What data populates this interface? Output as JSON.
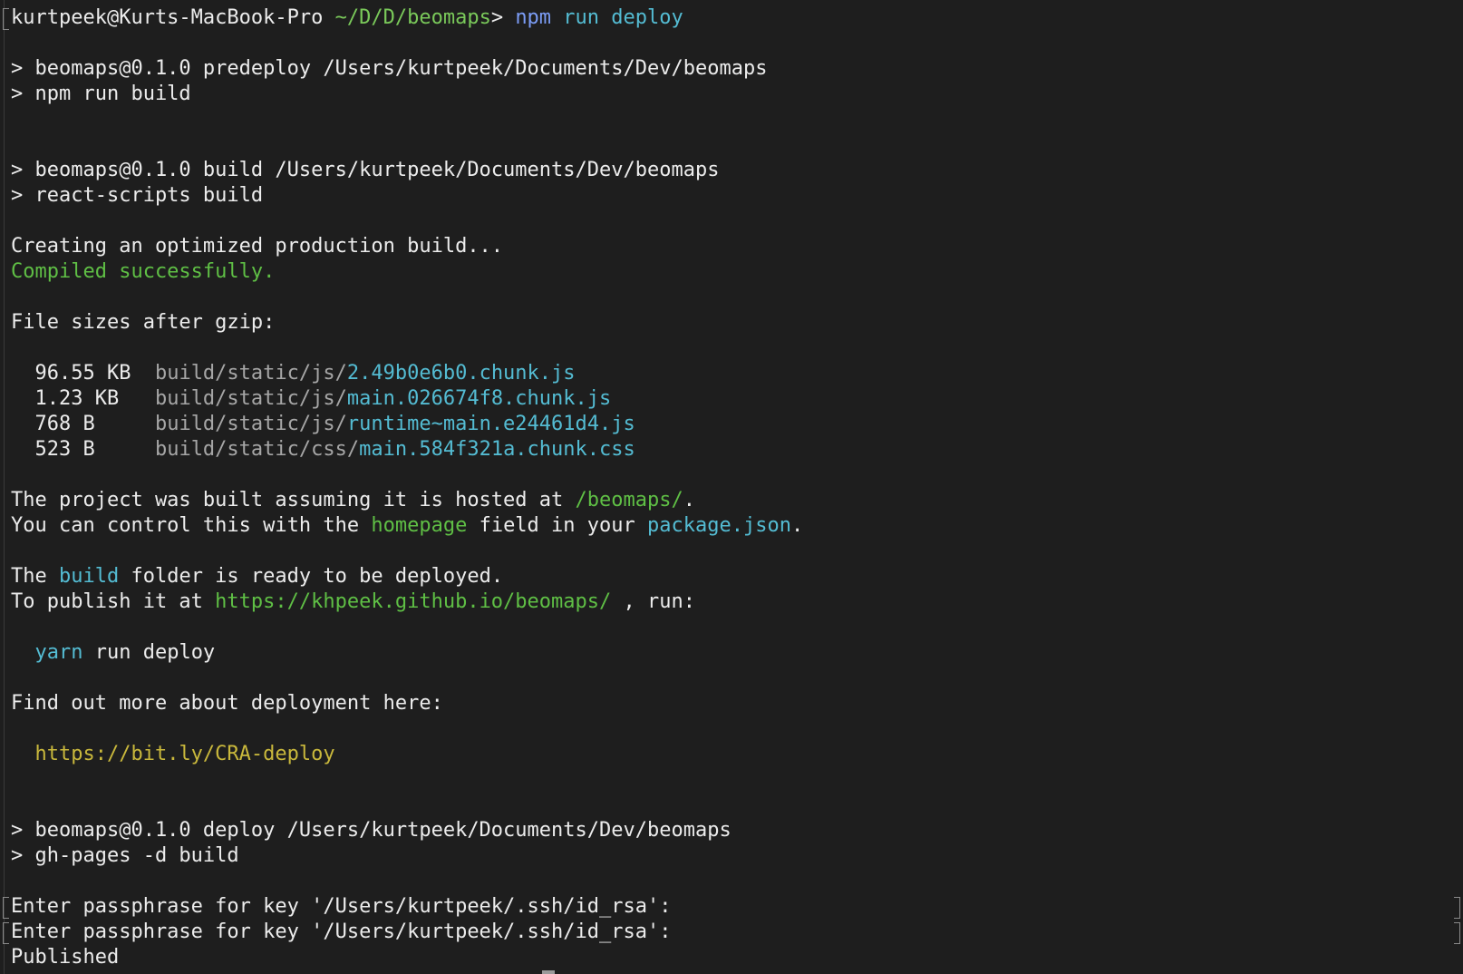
{
  "terminal": {
    "lines": [
      {
        "marker": "left",
        "segments": [
          {
            "text": "kurtpeek@Kurts-MacBook-Pro ",
            "color": "default"
          },
          {
            "text": "~/D/D/beomaps",
            "color": "pathgreen"
          },
          {
            "text": "> ",
            "color": "default"
          },
          {
            "text": "npm ",
            "color": "blue"
          },
          {
            "text": "run deploy",
            "color": "cyan"
          }
        ]
      },
      {
        "segments": []
      },
      {
        "segments": [
          {
            "text": "> beomaps@0.1.0 predeploy /Users/kurtpeek/Documents/Dev/beomaps",
            "color": "default"
          }
        ]
      },
      {
        "segments": [
          {
            "text": "> npm run build",
            "color": "default"
          }
        ]
      },
      {
        "segments": []
      },
      {
        "segments": []
      },
      {
        "segments": [
          {
            "text": "> beomaps@0.1.0 build /Users/kurtpeek/Documents/Dev/beomaps",
            "color": "default"
          }
        ]
      },
      {
        "segments": [
          {
            "text": "> react-scripts build",
            "color": "default"
          }
        ]
      },
      {
        "segments": []
      },
      {
        "segments": [
          {
            "text": "Creating an optimized production build...",
            "color": "default"
          }
        ]
      },
      {
        "segments": [
          {
            "text": "Compiled successfully.",
            "color": "green"
          }
        ]
      },
      {
        "segments": []
      },
      {
        "segments": [
          {
            "text": "File sizes after gzip:",
            "color": "default"
          }
        ]
      },
      {
        "segments": []
      },
      {
        "segments": [
          {
            "text": "  96.55 KB  ",
            "color": "default"
          },
          {
            "text": "build/static/js/",
            "color": "gray"
          },
          {
            "text": "2.49b0e6b0.chunk.js",
            "color": "cyan"
          }
        ]
      },
      {
        "segments": [
          {
            "text": "  1.23 KB   ",
            "color": "default"
          },
          {
            "text": "build/static/js/",
            "color": "gray"
          },
          {
            "text": "main.026674f8.chunk.js",
            "color": "cyan"
          }
        ]
      },
      {
        "segments": [
          {
            "text": "  768 B     ",
            "color": "default"
          },
          {
            "text": "build/static/js/",
            "color": "gray"
          },
          {
            "text": "runtime~main.e24461d4.js",
            "color": "cyan"
          }
        ]
      },
      {
        "segments": [
          {
            "text": "  523 B     ",
            "color": "default"
          },
          {
            "text": "build/static/css/",
            "color": "gray"
          },
          {
            "text": "main.584f321a.chunk.css",
            "color": "cyan"
          }
        ]
      },
      {
        "segments": []
      },
      {
        "segments": [
          {
            "text": "The project was built assuming it is hosted at ",
            "color": "default"
          },
          {
            "text": "/beomaps/",
            "color": "green"
          },
          {
            "text": ".",
            "color": "default"
          }
        ]
      },
      {
        "segments": [
          {
            "text": "You can control this with the ",
            "color": "default"
          },
          {
            "text": "homepage",
            "color": "green"
          },
          {
            "text": " field in your ",
            "color": "default"
          },
          {
            "text": "package.json",
            "color": "cyan"
          },
          {
            "text": ".",
            "color": "default"
          }
        ]
      },
      {
        "segments": []
      },
      {
        "segments": [
          {
            "text": "The ",
            "color": "default"
          },
          {
            "text": "build",
            "color": "cyan"
          },
          {
            "text": " folder is ready to be deployed.",
            "color": "default"
          }
        ]
      },
      {
        "segments": [
          {
            "text": "To publish it at ",
            "color": "default"
          },
          {
            "text": "https://khpeek.github.io/beomaps/",
            "color": "green"
          },
          {
            "text": " , run:",
            "color": "default"
          }
        ]
      },
      {
        "segments": []
      },
      {
        "segments": [
          {
            "text": "  ",
            "color": "default"
          },
          {
            "text": "yarn",
            "color": "cyan"
          },
          {
            "text": " run deploy",
            "color": "default"
          }
        ]
      },
      {
        "segments": []
      },
      {
        "segments": [
          {
            "text": "Find out more about deployment here:",
            "color": "default"
          }
        ]
      },
      {
        "segments": []
      },
      {
        "segments": [
          {
            "text": "  ",
            "color": "default"
          },
          {
            "text": "https://bit.ly/CRA-deploy",
            "color": "yellow"
          }
        ]
      },
      {
        "segments": []
      },
      {
        "segments": []
      },
      {
        "segments": [
          {
            "text": "> beomaps@0.1.0 deploy /Users/kurtpeek/Documents/Dev/beomaps",
            "color": "default"
          }
        ]
      },
      {
        "segments": [
          {
            "text": "> gh-pages -d build",
            "color": "default"
          }
        ]
      },
      {
        "segments": []
      },
      {
        "marker": "both",
        "segments": [
          {
            "text": "Enter passphrase for key '/Users/kurtpeek/.ssh/id_rsa':",
            "color": "default"
          }
        ]
      },
      {
        "marker": "both",
        "segments": [
          {
            "text": "Enter passphrase for key '/Users/kurtpeek/.ssh/id_rsa':",
            "color": "default"
          }
        ]
      },
      {
        "segments": [
          {
            "text": "Published",
            "color": "default"
          }
        ]
      }
    ]
  }
}
